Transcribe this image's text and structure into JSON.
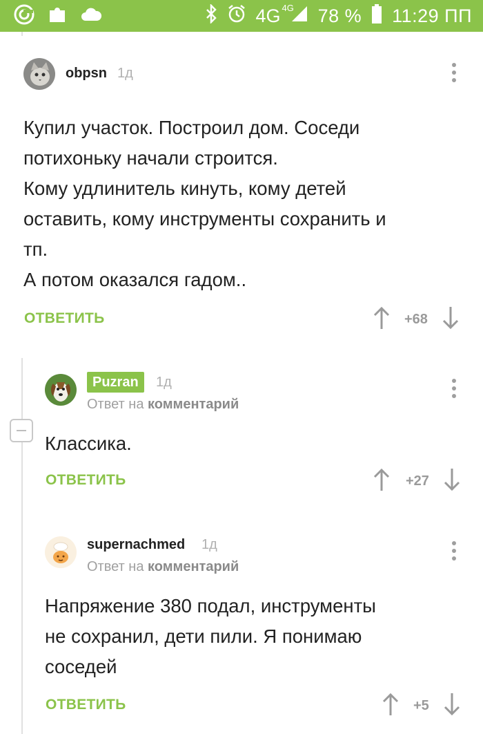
{
  "status": {
    "network": "4G",
    "network_sup": "4G",
    "battery": "78 %",
    "time": "11:29 ПП"
  },
  "comments": [
    {
      "user": "obpsn",
      "time": "1д",
      "text": [
        "Купил участок. Построил дом. Соседи",
        "потихоньку начали строится.",
        "Кому удлинитель кинуть, кому детей",
        "оставить, кому инструменты сохранить и",
        "тп.",
        "А потом оказался гадом.."
      ],
      "reply_label": "ОТВЕТИТЬ",
      "score": "+68"
    },
    {
      "user": "Puzran",
      "time": "1д",
      "reply_prefix": "Ответ на",
      "reply_target": "комментарий",
      "text": [
        "Классика."
      ],
      "reply_label": "ОТВЕТИТЬ",
      "score": "+27"
    },
    {
      "user": "supernachmed",
      "time": "1д",
      "reply_prefix": "Ответ на",
      "reply_target": "комментарий",
      "text": [
        "Напряжение 380 подал, инструменты",
        "не сохранил, дети пили.  Я понимаю",
        "соседей"
      ],
      "reply_label": "ОТВЕТИТЬ",
      "score": "+5"
    }
  ]
}
